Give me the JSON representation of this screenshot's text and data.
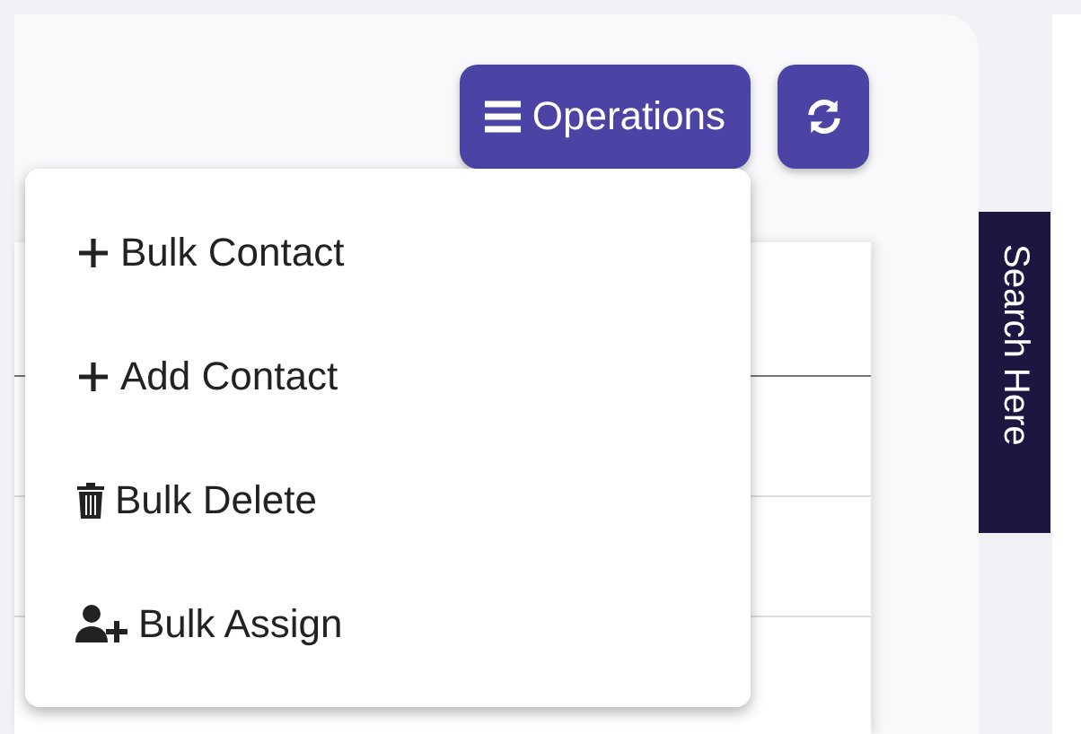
{
  "toolbar": {
    "operations_button": {
      "label": "Operations",
      "expanded": true
    }
  },
  "operations_menu": {
    "items": [
      {
        "kind": "plus",
        "label": "Bulk Contact"
      },
      {
        "kind": "plus",
        "label": "Add Contact"
      },
      {
        "kind": "trash",
        "label": "Bulk Delete"
      },
      {
        "kind": "user-plus",
        "label": "Bulk Assign"
      }
    ]
  },
  "side_tab": {
    "label": "Search Here"
  }
}
